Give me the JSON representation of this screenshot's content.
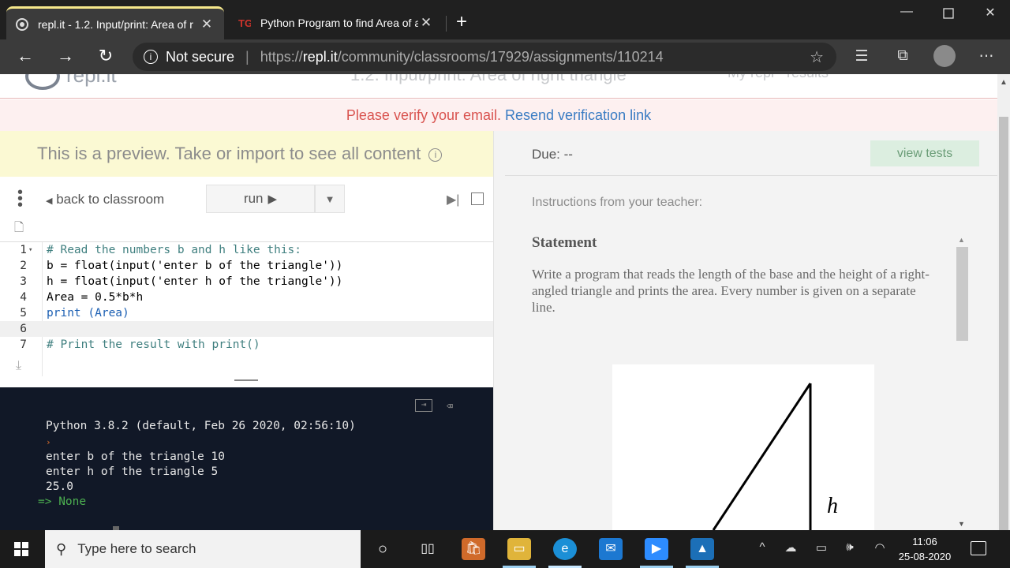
{
  "browser": {
    "tabs": [
      {
        "title": "repl.it - 1.2. Input/print: Area of r",
        "close": "✕"
      },
      {
        "title": "Python Program to find Area of a",
        "close": "✕"
      }
    ],
    "new_tab": "+",
    "security_label": "Not secure",
    "url_prefix": "https://",
    "url_domain": "repl.it",
    "url_path": "/community/classrooms/17929/assignments/110214"
  },
  "page_header": {
    "logo_text": "repl.it",
    "title_partial": "1.2. Input/print: Area of right triangle",
    "right_partial": "My repl · results"
  },
  "verify_banner": {
    "message": "Please verify your email.",
    "link": "Resend verification link"
  },
  "editor_pane": {
    "preview_text": "This is a preview. Take or import to see all content",
    "back_label": "back to classroom",
    "run_label": "run",
    "lines": [
      {
        "n": "1",
        "text": "# Read the numbers b and h like this:"
      },
      {
        "n": "2",
        "text": "b = float(input('enter b of the triangle'))"
      },
      {
        "n": "3",
        "text": "h = float(input('enter h of the triangle'))"
      },
      {
        "n": "4",
        "text": "Area = 0.5*b*h"
      },
      {
        "n": "5",
        "text": "print (Area)"
      },
      {
        "n": "6",
        "text": ""
      },
      {
        "n": "7",
        "text": "# Print the result with print()"
      }
    ]
  },
  "console": {
    "version": "Python 3.8.2 (default, Feb 26 2020, 02:56:10)",
    "out1": "enter b of the triangle 10",
    "out2": "enter h of the triangle 5",
    "out3": "25.0",
    "result": "=> None"
  },
  "instructions": {
    "due": "Due: --",
    "view_tests": "view tests",
    "from_teacher": "Instructions from your teacher:",
    "heading": "Statement",
    "body": "Write a program that reads the length of the base and the height of a right-angled triangle and prints the area. Every number is given on a separate line.",
    "figure_label": "h"
  },
  "taskbar": {
    "search_placeholder": "Type here to search",
    "time": "11:06",
    "date": "25-08-2020"
  }
}
